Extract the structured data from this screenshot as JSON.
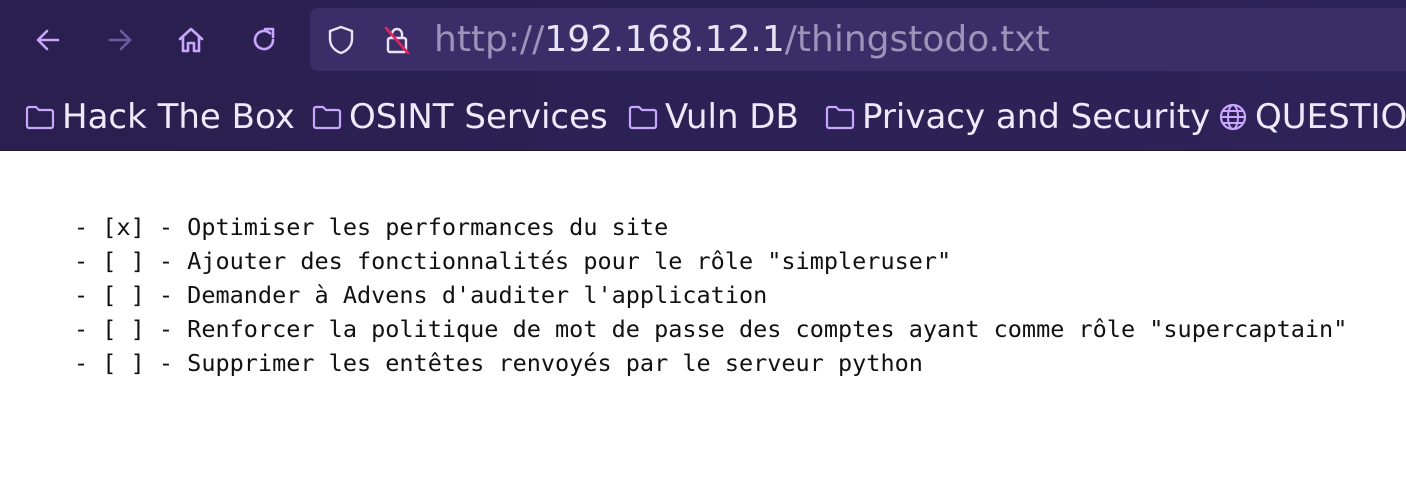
{
  "browser": {
    "url": {
      "scheme": "http://",
      "host": "192.168.12.1",
      "path": "/thingstodo.txt"
    },
    "nav_icons": [
      "back-arrow-icon",
      "forward-arrow-icon",
      "home-icon",
      "reload-icon"
    ],
    "url_icons": [
      "shield-icon",
      "insecure-lock-icon"
    ],
    "colors": {
      "chrome_bg": "#2c2155",
      "urlbar_bg": "#3a2d68",
      "icon_accent": "#c9a7ff",
      "insecure_red": "#e0245e"
    }
  },
  "bookmarks": [
    {
      "label": "Hack The Box",
      "icon": "folder-icon"
    },
    {
      "label": "OSINT Services",
      "icon": "folder-icon"
    },
    {
      "label": "Vuln DB",
      "icon": "folder-icon"
    },
    {
      "label": "Privacy and Security",
      "icon": "folder-icon"
    },
    {
      "label": "QUESTIO",
      "icon": "globe-icon"
    }
  ],
  "document": {
    "lines": [
      "- [x] - Optimiser les performances du site",
      "- [ ] - Ajouter des fonctionnalités pour le rôle \"simpleruser\"",
      "- [ ] - Demander à Advens d'auditer l'application",
      "- [ ] - Renforcer la politique de mot de passe des comptes ayant comme rôle \"supercaptain\"",
      "- [ ] - Supprimer les entêtes renvoyés par le serveur python"
    ]
  }
}
